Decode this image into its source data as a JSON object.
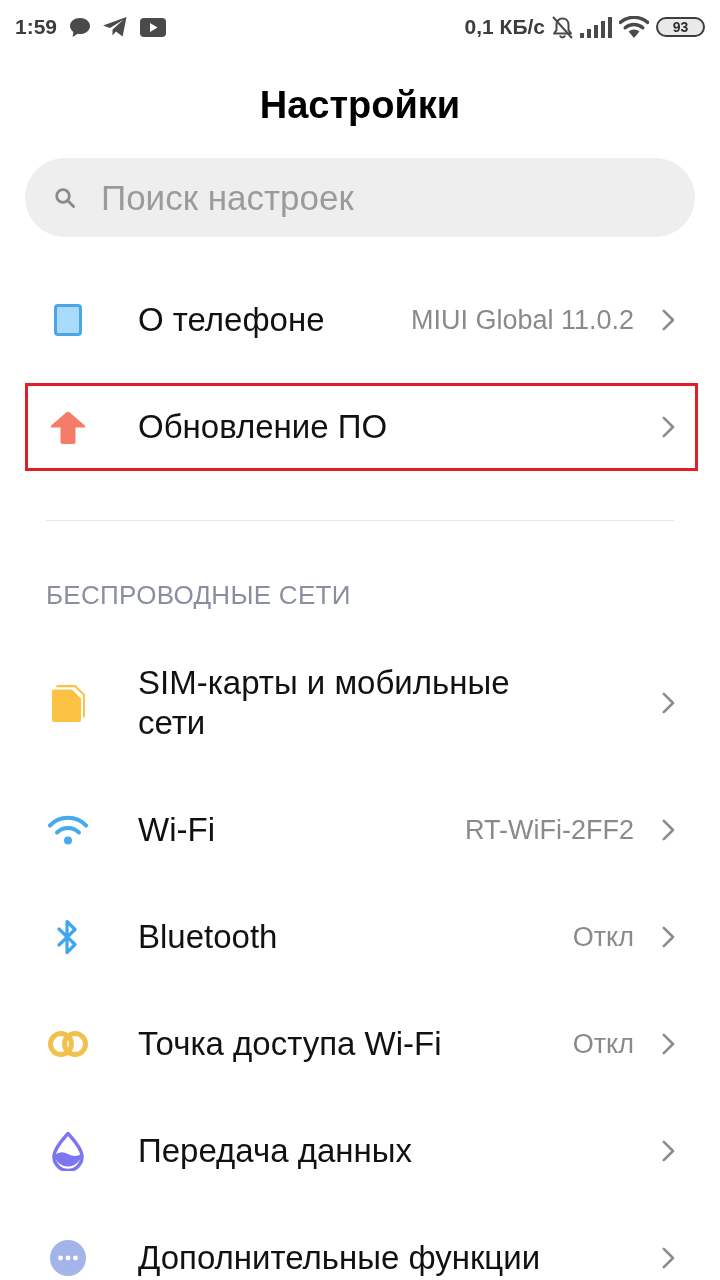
{
  "status_bar": {
    "time": "1:59",
    "network_speed": "0,1 КБ/с",
    "battery": "93"
  },
  "title": "Настройки",
  "search": {
    "placeholder": "Поиск настроек"
  },
  "groups": [
    {
      "items": [
        {
          "label": "О телефоне",
          "value": "MIUI Global 11.0.2",
          "highlighted": false
        },
        {
          "label": "Обновление ПО",
          "highlighted": true
        }
      ]
    },
    {
      "header": "БЕСПРОВОДНЫЕ СЕТИ",
      "items": [
        {
          "label": "SIM-карты и мобильные сети",
          "highlighted": false
        },
        {
          "label": "Wi-Fi",
          "value": "RT-WiFi-2FF2",
          "highlighted": false
        },
        {
          "label": "Bluetooth",
          "value": "Откл",
          "highlighted": false
        },
        {
          "label": "Точка доступа Wi-Fi",
          "value": "Откл",
          "highlighted": false
        },
        {
          "label": "Передача данных",
          "highlighted": false
        },
        {
          "label": "Дополнительные функции",
          "highlighted": false
        }
      ]
    }
  ]
}
